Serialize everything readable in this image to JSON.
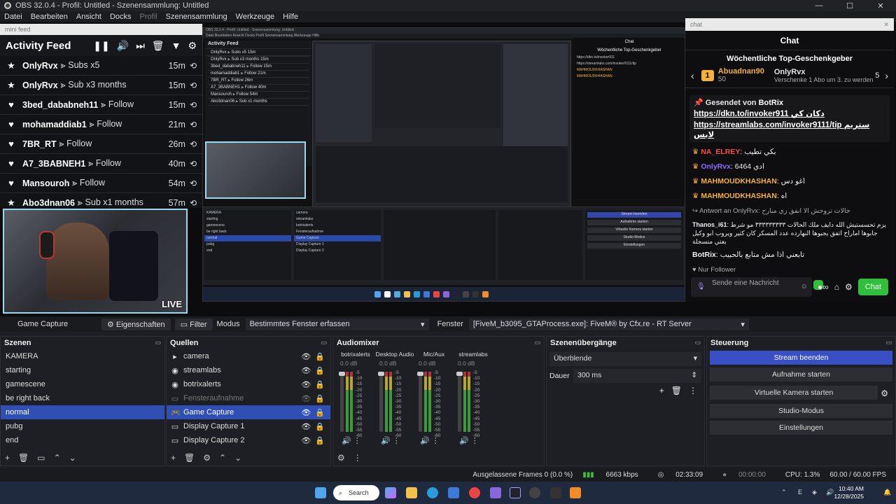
{
  "window": {
    "title": "OBS 32.0.4 - Profil: Untitled - Szenensammlung: Untitled",
    "controls": [
      "—",
      "☐",
      "✕"
    ]
  },
  "menu": [
    "Datei",
    "Bearbeiten",
    "Ansicht",
    "Docks",
    "Profil",
    "Szenensammlung",
    "Werkzeuge",
    "Hilfe"
  ],
  "feed_dock": {
    "header": "mini feed",
    "title": "Activity Feed",
    "items": [
      {
        "icon": "★",
        "name": "OnlyRvx",
        "event": "⪢ Subs x5",
        "time": "15m"
      },
      {
        "icon": "★",
        "name": "OnlyRvx",
        "event": "⪢ Sub x3 months",
        "time": "15m"
      },
      {
        "icon": "♥",
        "name": "3bed_dababneh11",
        "event": "⪢ Follow",
        "time": "15m"
      },
      {
        "icon": "♥",
        "name": "mohamaddiab1",
        "event": "⪢ Follow",
        "time": "21m"
      },
      {
        "icon": "♥",
        "name": "7BR_RT",
        "event": "⪢ Follow",
        "time": "26m"
      },
      {
        "icon": "♥",
        "name": "A7_3BABNEH1",
        "event": "⪢ Follow",
        "time": "40m"
      },
      {
        "icon": "♥",
        "name": "Mansouroh",
        "event": "⪢ Follow",
        "time": "54m"
      },
      {
        "icon": "★",
        "name": "Abo3dnan06",
        "event": "⪢ Sub x1 months",
        "time": "57m"
      }
    ]
  },
  "webcam": {
    "badge": "LIVE"
  },
  "chat_dock": {
    "header": "chat",
    "title": "Chat",
    "top_gifters_title": "Wöchentliche Top-Geschenkgeber",
    "gifter1": {
      "rank": "1",
      "name": "Abuadnan90",
      "count": "50"
    },
    "gifter2": {
      "name": "OnlyRvx",
      "count": "5",
      "note": "Verschenke 1 Abo um 3. zu werden"
    },
    "pinned_by": "Gesendet von",
    "pinned_user": "BotRix",
    "pinned_link1": "https://dkn.to/invoker911",
    "pinned_link1_suffix": "دكان كي",
    "pinned_link2": "https://streamlabs.com/invoker9111/tip",
    "pinned_link2_suffix": "ستريم لابس",
    "messages": [
      {
        "user": "NA_ELREY",
        "text": ": بكي تطيب"
      },
      {
        "user": "OnlyRvx",
        "text": ": 6464 ادي"
      },
      {
        "user": "MAHMOUDKHASHAN",
        "text": ": اغو دس"
      },
      {
        "user": "MAHMOUDKHASHAN",
        "text": ": اه"
      }
    ],
    "reply_to": "Antwort an OnlyRvx:",
    "reply_quote": "حالات تروحش الا انفق زي مبارح",
    "reply_user": "Thanos_i61",
    "reply_text": "يزم تحسستيش الله دايف ملك الحالات ٣٣٣٣٣٣٣٣٣ مو شرط جابوها اماراح اتفق يجبوها النهارده عدد المسكر كان كتير ويروب ابو وكيل بعتي منسجلة",
    "botrix_user": "BotRix",
    "botrix_text": "تابعني اذا مش متابع بالحبيب",
    "followers_only": "Nur Follower",
    "input_placeholder": "Sende eine Nachricht",
    "send_label": "Chat"
  },
  "context_bar": {
    "source": "Game Capture",
    "props": "Eigenschaften",
    "filter": "Filter",
    "mode_label": "Modus",
    "mode_value": "Bestimmtes Fenster erfassen",
    "window_label": "Fenster",
    "window_value": "[FiveM_b3095_GTAProcess.exe]: FiveM® by Cfx.re - RT Server"
  },
  "scenes": {
    "title": "Szenen",
    "items": [
      "KAMERA",
      "starting",
      "gamescene",
      "be right back",
      "normal",
      "pubg",
      "end"
    ],
    "selected": "normal"
  },
  "sources": {
    "title": "Quellen",
    "items": [
      {
        "name": "camera",
        "icon": "▸",
        "dim": false,
        "selected": false
      },
      {
        "name": "streamlabs",
        "icon": "◉",
        "dim": false,
        "selected": false
      },
      {
        "name": "botrixalerts",
        "icon": "◉",
        "dim": false,
        "selected": false
      },
      {
        "name": "Fensteraufnahme",
        "icon": "▭",
        "dim": true,
        "selected": false
      },
      {
        "name": "Game Capture",
        "icon": "🎮",
        "dim": false,
        "selected": true
      },
      {
        "name": "Display Capture 1",
        "icon": "▭",
        "dim": false,
        "selected": false
      },
      {
        "name": "Display Capture 2",
        "icon": "▭",
        "dim": false,
        "selected": false
      }
    ]
  },
  "mixer": {
    "title": "Audiomixer",
    "channels": [
      {
        "name": "botrixalerts",
        "db": "0.0 dB"
      },
      {
        "name": "Desktop Audio",
        "db": "0.0 dB"
      },
      {
        "name": "Mic/Aux",
        "db": "0.0 dB"
      },
      {
        "name": "streamlabs",
        "db": "0.0 dB"
      }
    ],
    "scale": [
      "-5",
      "-10",
      "-15",
      "-20",
      "-25",
      "-30",
      "-35",
      "-40",
      "-45",
      "-50",
      "-55",
      "-60"
    ]
  },
  "transitions": {
    "title": "Szenenübergänge",
    "type": "Überblende",
    "duration_label": "Dauer",
    "duration_value": "300 ms"
  },
  "controls": {
    "title": "Steuerung",
    "buttons": [
      "Stream beenden",
      "Aufnahme starten",
      "Virtuelle Kamera starten",
      "Studio-Modus",
      "Einstellungen"
    ]
  },
  "status": {
    "dropped": "Ausgelassene Frames 0 (0.0 %)",
    "bitrate": "6663 kbps",
    "stream_time": "02:33:09",
    "rec_time": "00:00:00",
    "cpu": "CPU: 1.3%",
    "fps": "60.00 / 60.00 FPS"
  },
  "taskbar": {
    "search": "Search",
    "time": "10:40 AM",
    "date": "12/28/2025"
  },
  "nested": {
    "title": "OBS 32.0.4 - Profil: Untitled - Szenensammlung: Untitled",
    "menu": "Datei  Bearbeiten  Ansicht  Docks  Profil  Szenensammlung  Werkzeuge  Hilfe",
    "feed_title": "Activity Feed",
    "feed_rows": [
      "OnlyRvx ⪢ Subs x5  15m",
      "OnlyRvx ⪢ Sub x3 months  15m",
      "3bed_dababneh11 ⪢ Follow  15m",
      "mohamaddiab1 ⪢ Follow  21m",
      "7BR_RT ⪢ Follow  26m",
      "A7_3BABNEH1 ⪢ Follow  40m",
      "Mansouroh ⪢ Follow  54m",
      "Abo3dnan06 ⪢ Sub x1 months"
    ],
    "chat_title": "Chat",
    "chat_sub": "Wöchentliche Top-Geschenkgeber",
    "scenes": [
      "KAMERA",
      "starting",
      "gamescene",
      "be right back",
      "normal",
      "pubg",
      "end"
    ],
    "sources": [
      "camera",
      "streamlabs",
      "botrixalerts",
      "Fensteraufnahme",
      "Game Capture",
      "Display Capture 1",
      "Display Capture 2"
    ],
    "controls": [
      "Stream beenden",
      "Aufnahme starten",
      "Virtuelle Kamera starten",
      "Studio-Modus",
      "Einstellungen"
    ]
  }
}
